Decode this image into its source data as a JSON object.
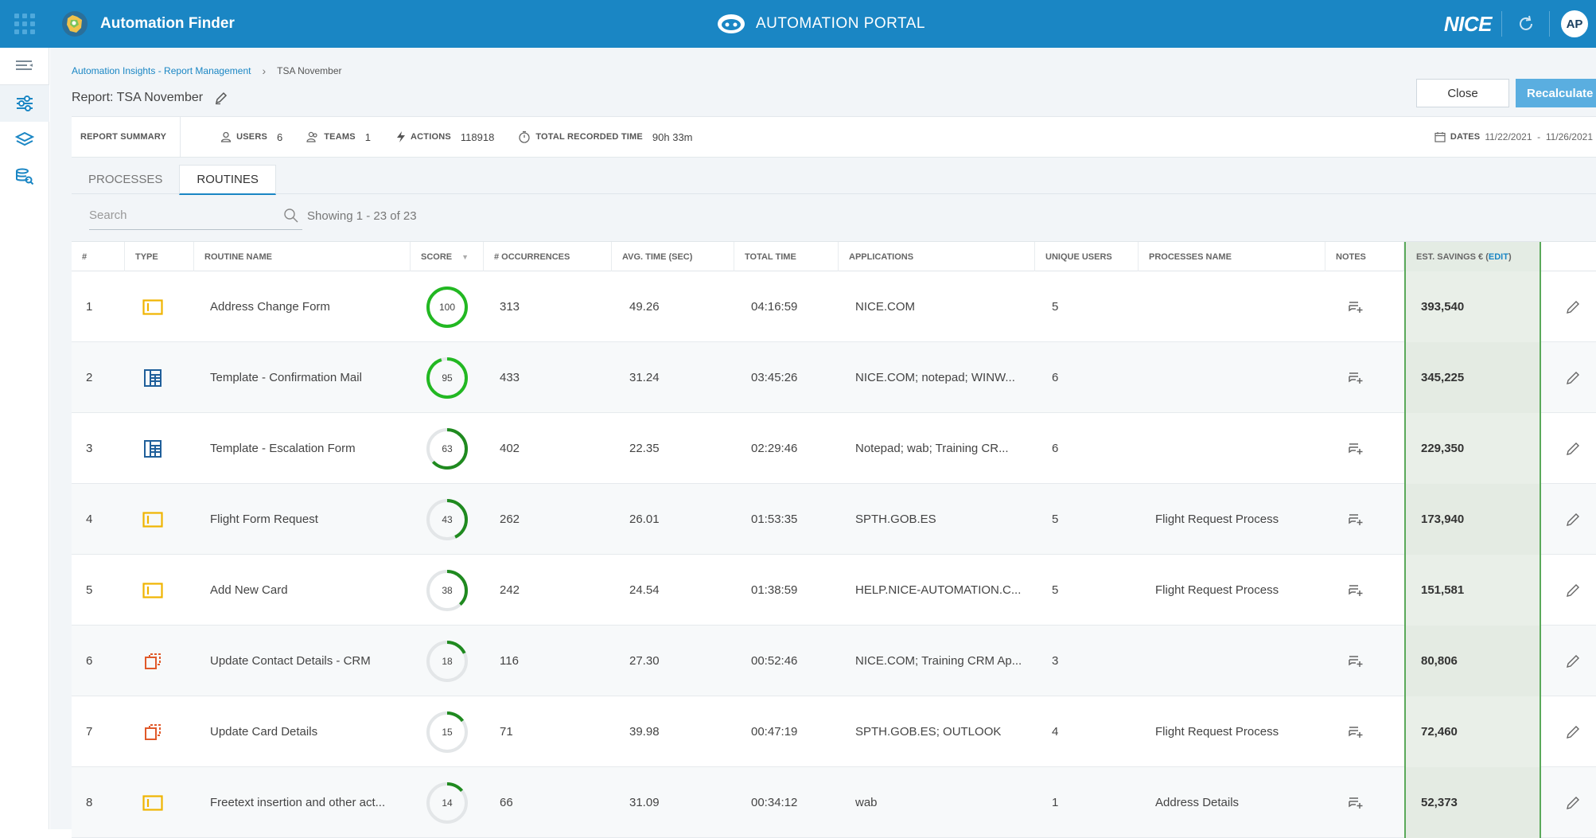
{
  "header": {
    "app_title": "Automation Finder",
    "portal_title": "AUTOMATION PORTAL",
    "brand": "NICE",
    "avatar_initials": "AP",
    "accent_color": "#1a86c4"
  },
  "breadcrumb": {
    "parent": "Automation Insights - Report Management",
    "current": "TSA November"
  },
  "report": {
    "title": "Report: TSA November",
    "close_label": "Close",
    "recalculate_label": "Recalculate"
  },
  "summary": {
    "title": "REPORT SUMMARY",
    "users_label": "USERS",
    "users_value": "6",
    "teams_label": "TEAMS",
    "teams_value": "1",
    "actions_label": "ACTIONS",
    "actions_value": "118918",
    "time_label": "TOTAL RECORDED TIME",
    "time_value": "90h 33m",
    "dates_label": "DATES",
    "dates_value": "11/22/2021  -  11/26/2021"
  },
  "tabs": [
    {
      "label": "PROCESSES",
      "active": false
    },
    {
      "label": "ROUTINES",
      "active": true
    }
  ],
  "search": {
    "placeholder": "Search",
    "showing": "Showing 1 - 23 of 23"
  },
  "table": {
    "columns": {
      "num": "#",
      "type": "TYPE",
      "name": "ROUTINE NAME",
      "score": "SCORE",
      "occurrences": "# OCCURRENCES",
      "avg_time": "AVG. TIME (SEC)",
      "total_time": "TOTAL TIME",
      "applications": "APPLICATIONS",
      "unique_users": "UNIQUE USERS",
      "processes": "PROCESSES NAME",
      "notes": "NOTES",
      "savings": "EST. SAVINGS € (",
      "savings_edit": "EDIT",
      "savings_close": ")"
    },
    "rows": [
      {
        "num": "1",
        "type": "form-icon",
        "name": "Address Change Form",
        "score": "100",
        "occurrences": "313",
        "avg_time": "49.26",
        "total_time": "04:16:59",
        "applications": "NICE.COM",
        "unique_users": "5",
        "processes": "",
        "savings": "393,540"
      },
      {
        "num": "2",
        "type": "table-icon",
        "name": "Template - Confirmation Mail",
        "score": "95",
        "occurrences": "433",
        "avg_time": "31.24",
        "total_time": "03:45:26",
        "applications": "NICE.COM; notepad; WINW...",
        "unique_users": "6",
        "processes": "",
        "savings": "345,225"
      },
      {
        "num": "3",
        "type": "table-icon",
        "name": "Template - Escalation Form",
        "score": "63",
        "occurrences": "402",
        "avg_time": "22.35",
        "total_time": "02:29:46",
        "applications": "Notepad; wab; Training CR...",
        "unique_users": "6",
        "processes": "",
        "savings": "229,350"
      },
      {
        "num": "4",
        "type": "form-icon",
        "name": "Flight Form Request",
        "score": "43",
        "occurrences": "262",
        "avg_time": "26.01",
        "total_time": "01:53:35",
        "applications": "SPTH.GOB.ES",
        "unique_users": "5",
        "processes": "Flight Request Process",
        "savings": "173,940"
      },
      {
        "num": "5",
        "type": "form-icon",
        "name": "Add New Card",
        "score": "38",
        "occurrences": "242",
        "avg_time": "24.54",
        "total_time": "01:38:59",
        "applications": "HELP.NICE-AUTOMATION.C...",
        "unique_users": "5",
        "processes": "Flight Request Process",
        "savings": "151,581"
      },
      {
        "num": "6",
        "type": "copy-icon",
        "name": "Update Contact Details - CRM",
        "score": "18",
        "occurrences": "116",
        "avg_time": "27.30",
        "total_time": "00:52:46",
        "applications": "NICE.COM; Training CRM Ap...",
        "unique_users": "3",
        "processes": "",
        "savings": "80,806"
      },
      {
        "num": "7",
        "type": "copy-icon",
        "name": "Update Card Details",
        "score": "15",
        "occurrences": "71",
        "avg_time": "39.98",
        "total_time": "00:47:19",
        "applications": "SPTH.GOB.ES; OUTLOOK",
        "unique_users": "4",
        "processes": "Flight Request Process",
        "savings": "72,460"
      },
      {
        "num": "8",
        "type": "form-icon",
        "name": "Freetext insertion and other act...",
        "score": "14",
        "occurrences": "66",
        "avg_time": "31.09",
        "total_time": "00:34:12",
        "applications": "wab",
        "unique_users": "1",
        "processes": "Address Details",
        "savings": "52,373"
      }
    ]
  },
  "colors": {
    "form": "#f0b400",
    "table": "#1f5f9a",
    "copy": "#e0592a",
    "score_high": "#22b822",
    "score_mid": "#1f8a1f",
    "score_track": "#e3e6e8",
    "savings_border": "#5aa95a"
  }
}
